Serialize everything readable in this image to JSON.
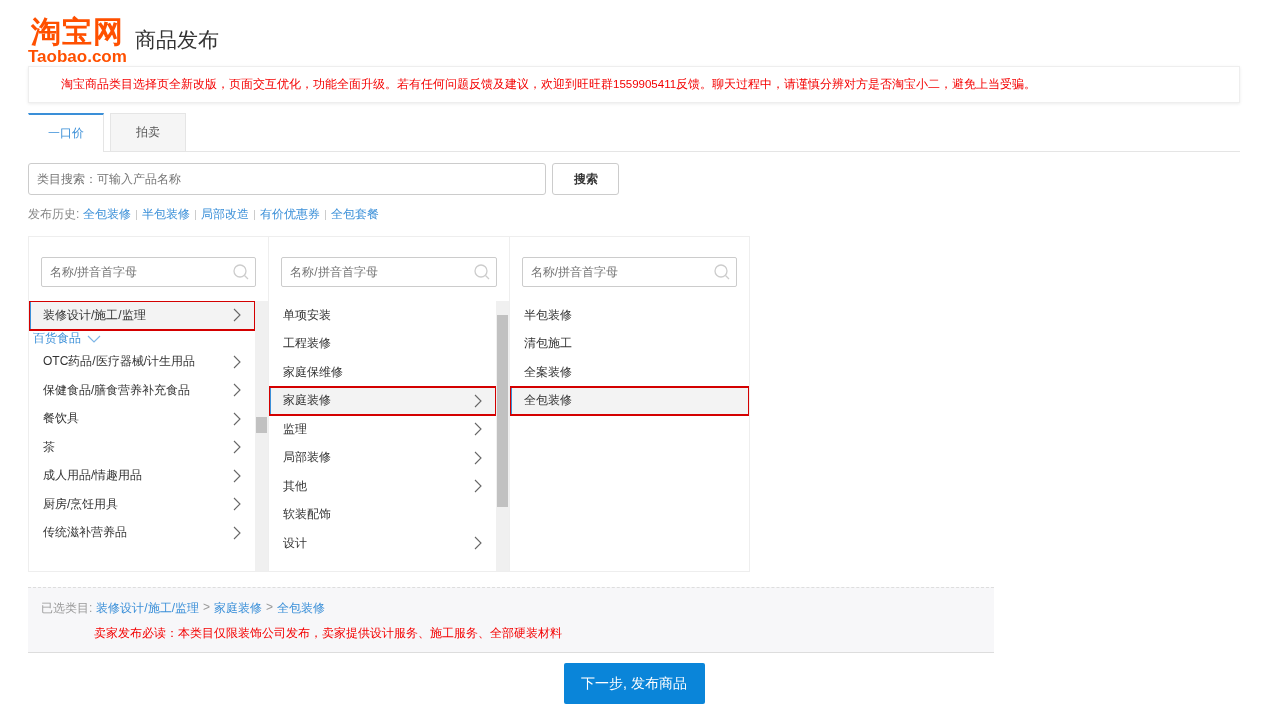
{
  "header": {
    "logo_text": "淘宝网",
    "logo_domain": "Taobao.com",
    "title": "商品发布"
  },
  "notice": "淘宝商品类目选择页全新改版，页面交互优化，功能全面升级。若有任何问题反馈及建议，欢迎到旺旺群1559905411反馈。聊天过程中，请谨慎分辨对方是否淘宝小二，避免上当受骗。",
  "tabs": [
    {
      "label": "一口价",
      "selected": true
    },
    {
      "label": "拍卖",
      "selected": false
    }
  ],
  "search": {
    "placeholder": "类目搜索：可输入产品名称",
    "button": "搜索"
  },
  "history": {
    "label": "发布历史:",
    "links": [
      "全包装修",
      "半包装修",
      "局部改造",
      "有价优惠券",
      "全包套餐"
    ]
  },
  "columns": [
    {
      "placeholder": "名称/拼音首字母",
      "scrollbar": true,
      "items": [
        {
          "kind": "item",
          "label": "装修设计/施工/监理",
          "has_children": true,
          "selected": true
        },
        {
          "kind": "group",
          "label": "百货食品"
        },
        {
          "kind": "item",
          "label": "OTC药品/医疗器械/计生用品",
          "has_children": true,
          "selected": false
        },
        {
          "kind": "item",
          "label": "保健食品/膳食营养补充食品",
          "has_children": true,
          "selected": false
        },
        {
          "kind": "item",
          "label": "餐饮具",
          "has_children": true,
          "selected": false
        },
        {
          "kind": "item",
          "label": "茶",
          "has_children": true,
          "selected": false
        },
        {
          "kind": "item",
          "label": "成人用品/情趣用品",
          "has_children": true,
          "selected": false
        },
        {
          "kind": "item",
          "label": "厨房/烹饪用具",
          "has_children": true,
          "selected": false
        },
        {
          "kind": "item",
          "label": "传统滋补营养品",
          "has_children": true,
          "selected": false
        }
      ]
    },
    {
      "placeholder": "名称/拼音首字母",
      "scrollbar": true,
      "items": [
        {
          "kind": "item",
          "label": "单项安装",
          "has_children": false,
          "selected": false
        },
        {
          "kind": "item",
          "label": "工程装修",
          "has_children": false,
          "selected": false
        },
        {
          "kind": "item",
          "label": "家庭保维修",
          "has_children": false,
          "selected": false
        },
        {
          "kind": "item",
          "label": "家庭装修",
          "has_children": true,
          "selected": true
        },
        {
          "kind": "item",
          "label": "监理",
          "has_children": true,
          "selected": false
        },
        {
          "kind": "item",
          "label": "局部装修",
          "has_children": true,
          "selected": false
        },
        {
          "kind": "item",
          "label": "其他",
          "has_children": true,
          "selected": false
        },
        {
          "kind": "item",
          "label": "软装配饰",
          "has_children": false,
          "selected": false
        },
        {
          "kind": "item",
          "label": "设计",
          "has_children": true,
          "selected": false
        }
      ]
    },
    {
      "placeholder": "名称/拼音首字母",
      "scrollbar": false,
      "items": [
        {
          "kind": "item",
          "label": "半包装修",
          "has_children": false,
          "selected": false
        },
        {
          "kind": "item",
          "label": "清包施工",
          "has_children": false,
          "selected": false
        },
        {
          "kind": "item",
          "label": "全案装修",
          "has_children": false,
          "selected": false
        },
        {
          "kind": "item",
          "label": "全包装修",
          "has_children": false,
          "selected": true
        }
      ]
    }
  ],
  "selected_path": {
    "label": "已选类目:",
    "parts": [
      "装修设计/施工/监理",
      "家庭装修",
      "全包装修"
    ],
    "separator": ">",
    "warning": "卖家发布必读：本类目仅限装饰公司发布，卖家提供设计服务、施工服务、全部硬装材料"
  },
  "next_button": "下一步, 发布商品"
}
